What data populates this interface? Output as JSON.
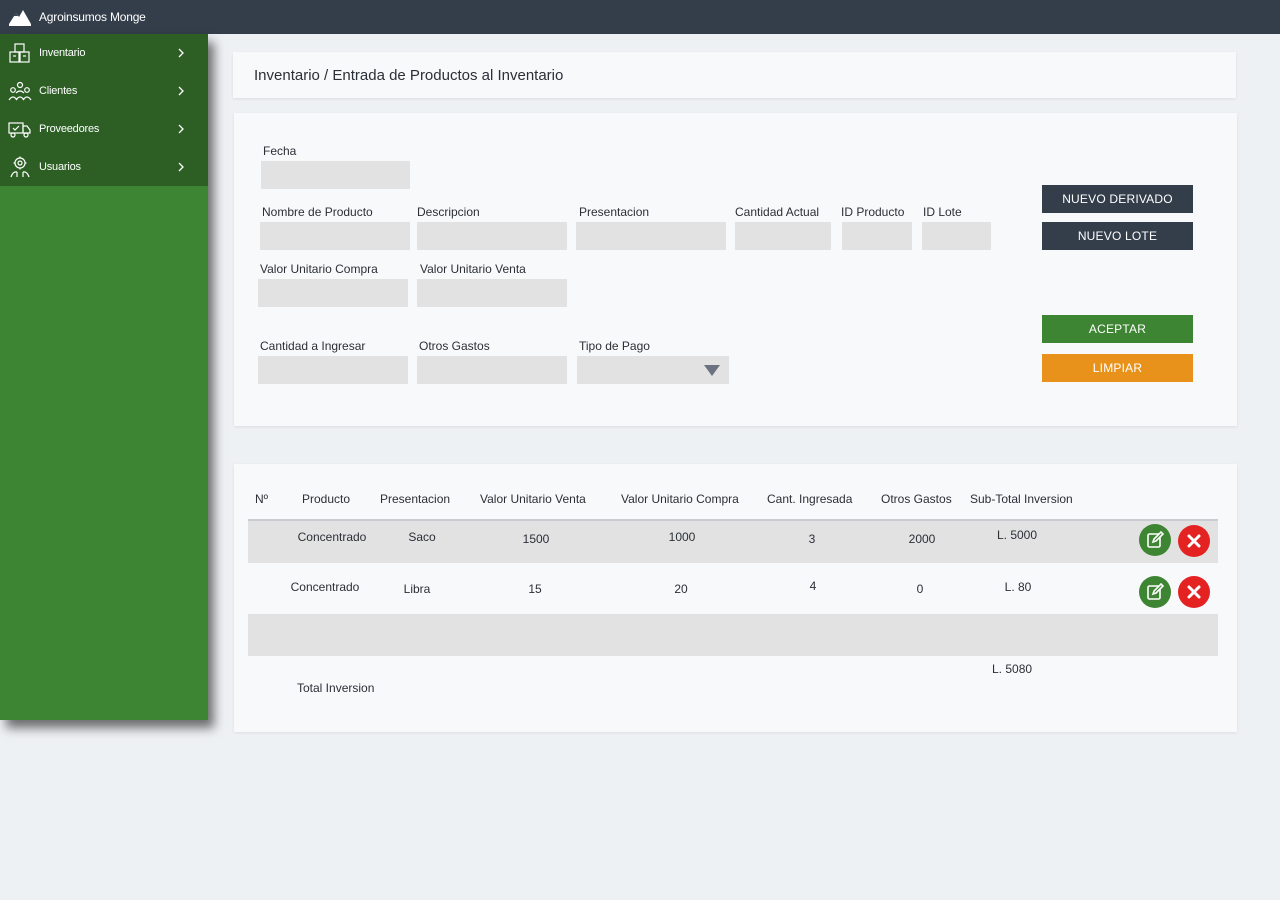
{
  "app": {
    "brand": "Agroinsumos Monge"
  },
  "sidebar": {
    "items": [
      {
        "label": "Inventario",
        "icon": "boxes-icon"
      },
      {
        "label": "Clientes",
        "icon": "people-icon"
      },
      {
        "label": "Proveedores",
        "icon": "truck-icon"
      },
      {
        "label": "Usuarios",
        "icon": "user-gear-icon"
      }
    ]
  },
  "breadcrumb": "Inventario / Entrada de Productos al Inventario",
  "form": {
    "fecha_label": "Fecha",
    "nombre_label": "Nombre de Producto",
    "descripcion_label": "Descripcion",
    "presentacion_label": "Presentacion",
    "cantidad_actual_label": "Cantidad Actual",
    "id_producto_label": "ID Producto",
    "id_lote_label": "ID Lote",
    "valor_compra_label": "Valor Unitario Compra",
    "valor_venta_label": "Valor Unitario Venta",
    "cantidad_ingresar_label": "Cantidad a Ingresar",
    "otros_gastos_label": "Otros Gastos",
    "tipo_pago_label": "Tipo de Pago"
  },
  "buttons": {
    "nuevo_derivado": "NUEVO DERIVADO",
    "nuevo_lote": "NUEVO LOTE",
    "aceptar": "ACEPTAR",
    "limpiar": "LIMPIAR"
  },
  "colors": {
    "topbar": "#343e4b",
    "sidebar": "#3e8533",
    "accent_orange": "#e8921b",
    "delete_red": "#e52222"
  },
  "table": {
    "headers": [
      "Nº",
      "Producto",
      "Presentacion",
      "Valor Unitario Venta",
      "Valor Unitario Compra",
      "Cant. Ingresada",
      "Otros Gastos",
      "Sub-Total Inversion"
    ],
    "rows": [
      {
        "producto": "Concentrado",
        "presentacion": "Saco",
        "venta": "1500",
        "compra": "1000",
        "cantidad": "3",
        "otros": "2000",
        "subtotal": "L. 5000"
      },
      {
        "producto": "Concentrado",
        "presentacion": "Libra",
        "venta": "15",
        "compra": "20",
        "cantidad": "4",
        "otros": "0",
        "subtotal": "L. 80"
      }
    ],
    "total_label": "Total Inversion",
    "total_value": "L. 5080"
  }
}
